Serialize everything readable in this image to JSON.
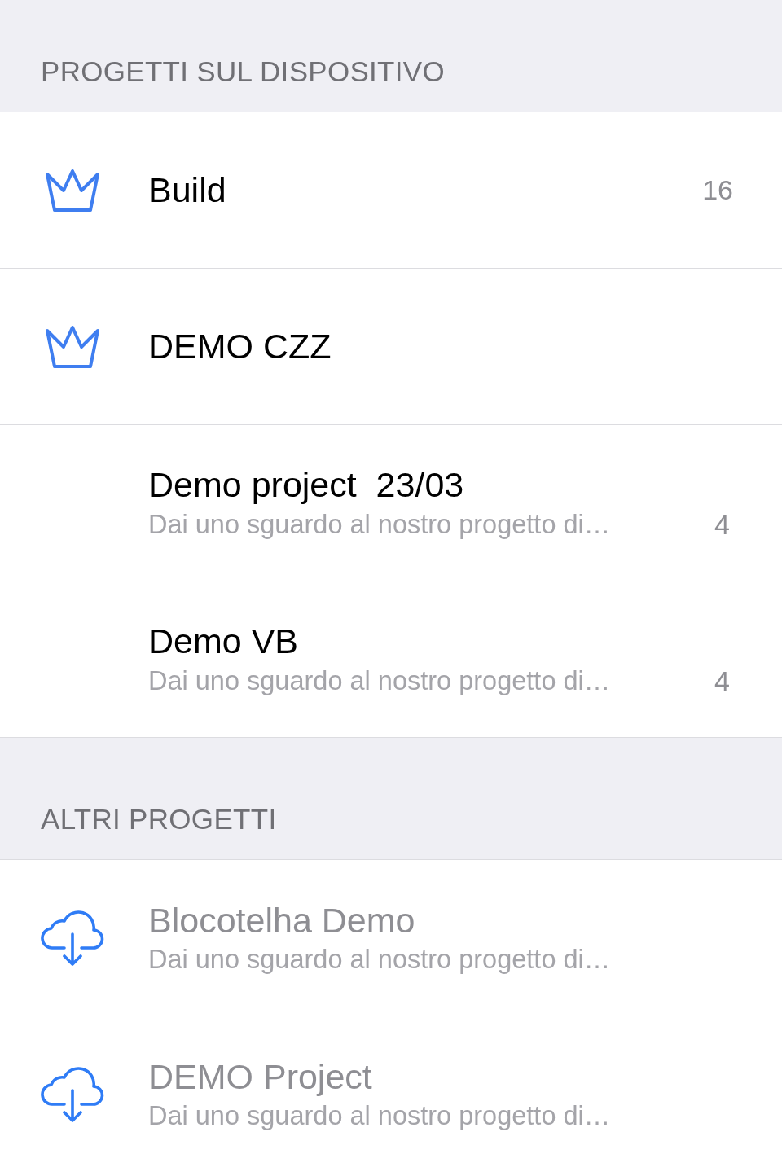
{
  "sections": [
    {
      "title": "PROGETTI SUL DISPOSITIVO",
      "items": [
        {
          "kind": "crown",
          "title": "Build",
          "count": "16",
          "disabled": false
        },
        {
          "kind": "crown",
          "title": "DEMO CZZ",
          "disabled": false
        },
        {
          "kind": "plain",
          "title": "Demo project  23/03",
          "subtitle": "Dai uno sguardo al nostro progetto di…",
          "count": "4",
          "disabled": false
        },
        {
          "kind": "plain",
          "title": "Demo VB",
          "subtitle": "Dai uno sguardo al nostro progetto di…",
          "count": "4",
          "disabled": false
        }
      ]
    },
    {
      "title": "ALTRI PROGETTI",
      "items": [
        {
          "kind": "cloud",
          "title": "Blocotelha Demo",
          "subtitle": "Dai uno sguardo al nostro progetto di…",
          "disabled": true
        },
        {
          "kind": "cloud",
          "title": "DEMO Project",
          "subtitle": "Dai uno sguardo al nostro progetto di…",
          "disabled": true
        }
      ]
    }
  ]
}
